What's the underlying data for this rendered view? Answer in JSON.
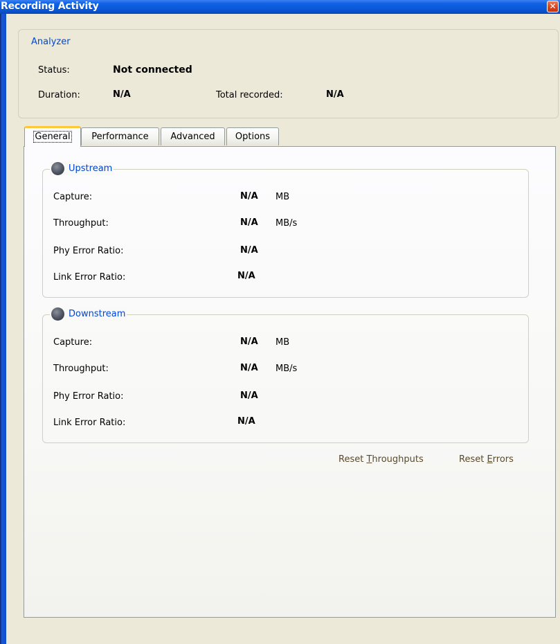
{
  "window": {
    "title": "Recording Activity",
    "close_glyph": "✕"
  },
  "analyzer": {
    "legend": "Analyzer",
    "status_label": "Status:",
    "status_value": "Not connected",
    "duration_label": "Duration:",
    "duration_value": "N/A",
    "total_label": "Total recorded:",
    "total_value": "N/A"
  },
  "tabs": [
    {
      "label": "General",
      "active": true
    },
    {
      "label": "Performance",
      "active": false
    },
    {
      "label": "Advanced",
      "active": false
    },
    {
      "label": "Options",
      "active": false
    }
  ],
  "upstream": {
    "title": "Upstream",
    "rows": [
      {
        "label": "Capture:",
        "value": "N/A",
        "unit": "MB"
      },
      {
        "label": "Throughput:",
        "value": "N/A",
        "unit": "MB/s"
      },
      {
        "label": "Phy Error Ratio:",
        "value": "N/A",
        "unit": ""
      },
      {
        "label": "Link Error Ratio:",
        "value": "N/A",
        "unit": ""
      }
    ]
  },
  "downstream": {
    "title": "Downstream",
    "rows": [
      {
        "label": "Capture:",
        "value": "N/A",
        "unit": "MB"
      },
      {
        "label": "Throughput:",
        "value": "N/A",
        "unit": "MB/s"
      },
      {
        "label": "Phy Error Ratio:",
        "value": "N/A",
        "unit": ""
      },
      {
        "label": "Link Error Ratio:",
        "value": "N/A",
        "unit": ""
      }
    ]
  },
  "actions": {
    "reset_throughputs_pre": "Reset ",
    "reset_throughputs_key": "T",
    "reset_throughputs_post": "hroughputs",
    "reset_errors_pre": "Reset ",
    "reset_errors_key": "E",
    "reset_errors_post": "rrors"
  },
  "colors": {
    "title_bar": "#0a56d6",
    "legend_text": "#0046d5",
    "dialog_bg": "#ece9d8",
    "tab_highlight": "#ffc83c"
  }
}
